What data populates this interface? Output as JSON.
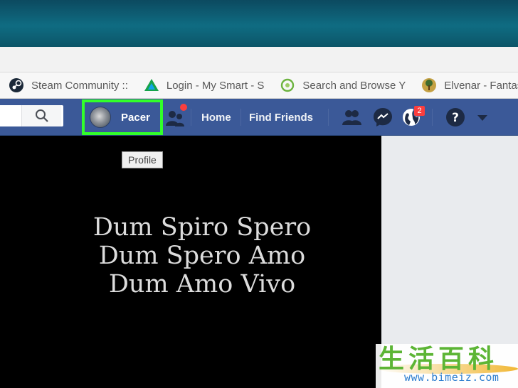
{
  "bookmarks": [
    {
      "icon": "steam-icon",
      "label": "Steam Community ::"
    },
    {
      "icon": "smart-triangle-icon",
      "label": "Login - My Smart - S"
    },
    {
      "icon": "green-circle-icon",
      "label": "Search and Browse Y"
    },
    {
      "icon": "tree-emblem-icon",
      "label": "Elvenar - Fantasy C"
    }
  ],
  "facebook": {
    "profile_name": "Pacer",
    "nav_home": "Home",
    "nav_find_friends": "Find Friends",
    "notifications_count": "2",
    "brand_color": "#3b5998",
    "highlight_color": "#32ff2a"
  },
  "tooltip": {
    "text": "Profile"
  },
  "content": {
    "quote_lines": [
      "Dum Spiro Spero",
      "Dum Spero Amo",
      "Dum Amo Vivo"
    ]
  },
  "watermark": {
    "chars": [
      "生",
      "活",
      "百",
      "科"
    ],
    "url": "www.bimeiz.com"
  }
}
